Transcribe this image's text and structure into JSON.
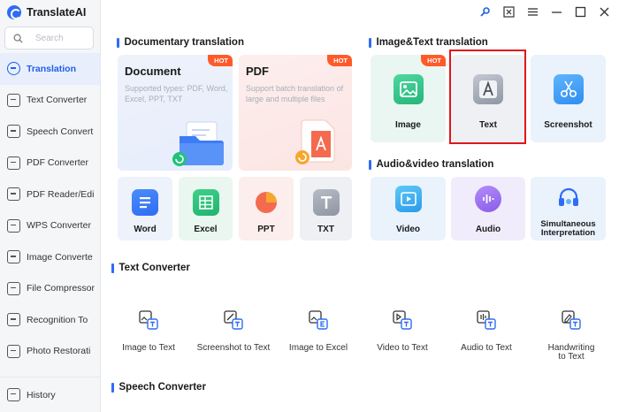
{
  "app": {
    "title": "TranslateAI"
  },
  "search": {
    "placeholder": "Search"
  },
  "sidebar": {
    "items": [
      {
        "label": "Translation",
        "icon": "translate-icon",
        "active": true
      },
      {
        "label": "Text Converter",
        "icon": "text-converter-icon"
      },
      {
        "label": "Speech Convert",
        "icon": "speech-icon"
      },
      {
        "label": "PDF Converter",
        "icon": "pdf-icon"
      },
      {
        "label": "PDF Reader/Edi",
        "icon": "pdf-reader-icon"
      },
      {
        "label": "WPS Converter",
        "icon": "wps-icon"
      },
      {
        "label": "Image Converte",
        "icon": "image-icon"
      },
      {
        "label": "File Compressor",
        "icon": "compress-icon"
      },
      {
        "label": "Recognition To",
        "icon": "recognition-icon"
      },
      {
        "label": "Photo Restorati",
        "icon": "photo-restore-icon"
      }
    ],
    "history": "History"
  },
  "doc_section": {
    "title": "Documentary translation",
    "document": {
      "title": "Document",
      "desc": "Supported types: PDF, Word, Excel, PPT, TXT",
      "badge": "HOT"
    },
    "pdf": {
      "title": "PDF",
      "desc": "Support batch translation of large and multiple files",
      "badge": "HOT"
    },
    "tiles": [
      "Word",
      "Excel",
      "PPT",
      "TXT"
    ]
  },
  "imgtext_section": {
    "title": "Image&Text translation",
    "tiles": [
      "Image",
      "Text",
      "Screenshot"
    ],
    "badge": "HOT"
  },
  "av_section": {
    "title": "Audio&video translation",
    "tiles": [
      "Video",
      "Audio",
      "Simultaneous Interpretation"
    ]
  },
  "text_converter": {
    "title": "Text Converter",
    "tools": [
      "Image to Text",
      "Screenshot to Text",
      "Image to Excel",
      "Video to Text",
      "Audio to Text",
      "Handwriting to Text"
    ]
  },
  "speech_converter": {
    "title": "Speech Converter"
  },
  "colors": {
    "accent": "#2f6cf6",
    "hot": "#ff5a2a",
    "highlight": "#e0161c"
  }
}
